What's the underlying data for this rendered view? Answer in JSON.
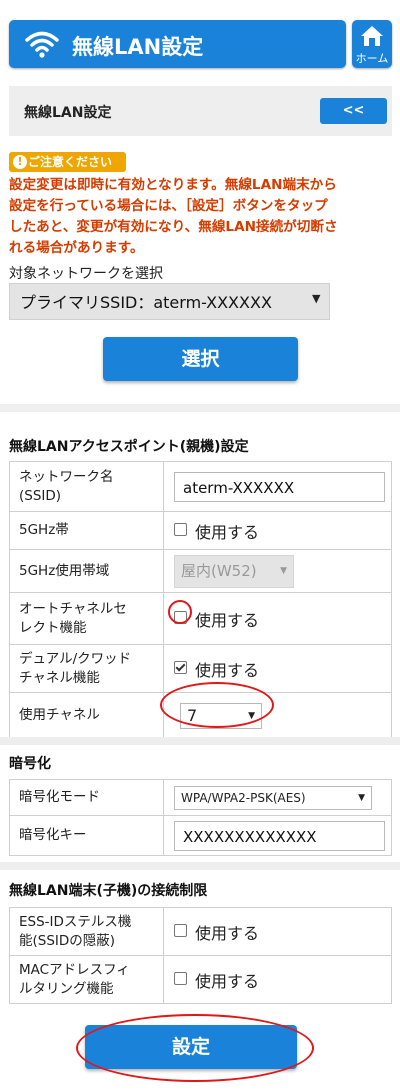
{
  "header": {
    "title": "無線LAN設定",
    "home_label": "ホーム"
  },
  "subbar": {
    "title": "無線LAN設定",
    "back_label": "<<"
  },
  "notice": {
    "badge": "ご注意ください",
    "lines": [
      "設定変更は即時に有効となります。無線LAN端末から",
      "設定を行っている場合には、［設定］ボタンをタップ",
      "したあと、変更が有効になり、無線LAN接続が切断さ",
      "れる場合があります。"
    ]
  },
  "network_select": {
    "label": "対象ネットワークを選択",
    "value": "プライマリSSID：aterm-XXXXXX",
    "button": "選択"
  },
  "access_point": {
    "title": "無線LANアクセスポイント(親機)設定",
    "ssid_label_1": "ネットワーク名",
    "ssid_label_2": "(SSID)",
    "ssid_value": "aterm-XXXXXX",
    "band5_label": "5GHz帯",
    "band5_check": "使用する",
    "band5_checked": false,
    "band5_range_label": "5GHz使用帯域",
    "band5_range_value": "屋内(W52)",
    "auto_channel_label_1": "オートチャネルセ",
    "auto_channel_label_2": "レクト機能",
    "auto_channel_check": "使用する",
    "auto_channel_checked": false,
    "dual_label_1": "デュアル/クワッド",
    "dual_label_2": "チャネル機能",
    "dual_check": "使用する",
    "dual_checked": true,
    "channel_label": "使用チャネル",
    "channel_value": "7"
  },
  "encryption": {
    "title": "暗号化",
    "mode_label": "暗号化モード",
    "mode_value": "WPA/WPA2-PSK(AES)",
    "key_label": "暗号化キー",
    "key_value": "XXXXXXXXXXXXX"
  },
  "restriction": {
    "title": "無線LAN端末(子機)の接続制限",
    "stealth_label_1": "ESS-IDステルス機",
    "stealth_label_2": "能(SSIDの隠蔽)",
    "stealth_check": "使用する",
    "stealth_checked": false,
    "mac_label_1": "MACアドレスフィ",
    "mac_label_2": "ルタリング機能",
    "mac_check": "使用する",
    "mac_checked": false
  },
  "footer": {
    "set_button": "設定"
  },
  "colors": {
    "accent": "#1a82d8",
    "warning": "#d43c00",
    "notice_badge": "#f0a600",
    "annotation": "#e01818"
  },
  "icons": {
    "wifi": "wifi-icon",
    "home": "home-icon",
    "alert": "alert-icon",
    "dropdown": "dropdown-arrow-icon"
  }
}
